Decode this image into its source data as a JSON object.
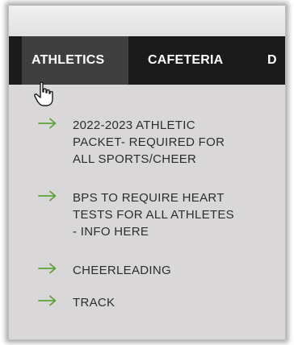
{
  "nav": {
    "tabs": [
      {
        "label": "ATHLETICS",
        "active": true
      },
      {
        "label": "CAFETERIA",
        "active": false
      },
      {
        "label": "D",
        "active": false
      }
    ]
  },
  "menu": {
    "items": [
      {
        "icon": "arrow-right-icon",
        "lines": [
          "2022-2023 ATHLETIC",
          "PACKET- REQUIRED FOR",
          "ALL SPORTS/CHEER"
        ]
      },
      {
        "icon": "arrow-right-icon",
        "lines": [
          "BPS TO REQUIRE HEART",
          "TESTS FOR ALL ATHLETES",
          "- INFO HERE"
        ]
      },
      {
        "icon": "arrow-right-icon",
        "lines": [
          "CHEERLEADING"
        ]
      },
      {
        "icon": "arrow-right-icon",
        "lines": [
          "TRACK"
        ]
      }
    ]
  },
  "colors": {
    "navbar": "#1b1b1b",
    "active_tab": "#3f3f3f",
    "arrow": "#5fa13a",
    "text": "#2d2d2d",
    "page": "#d9d7d8"
  }
}
